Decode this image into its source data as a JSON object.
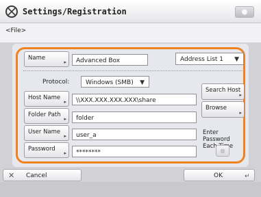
{
  "header": {
    "title": "Settings/Registration",
    "icon": "settings-registration-icon"
  },
  "breadcrumb": "<File>",
  "form": {
    "name_button": "Name",
    "name_value": "Advanced Box",
    "address_list": "Address List 1",
    "protocol_label": "Protocol:",
    "protocol_value": "Windows (SMB)",
    "host_name_button": "Host Name",
    "host_name_value": "\\\\XXX.XXX.XXX.XXX\\share",
    "folder_path_button": "Folder Path",
    "folder_path_value": "folder",
    "user_name_button": "User Name",
    "user_name_value": "user_a",
    "password_button": "Password",
    "password_value": "********",
    "search_host_button": "Search Host",
    "browse_button": "Browse",
    "enter_password_label": "Enter Password Each Time",
    "enter_password_checked": false
  },
  "footer": {
    "cancel_label": "Cancel",
    "ok_label": "OK"
  },
  "colors": {
    "accent_frame": "#f0821e",
    "panel_bg": "#e6e8ee"
  }
}
